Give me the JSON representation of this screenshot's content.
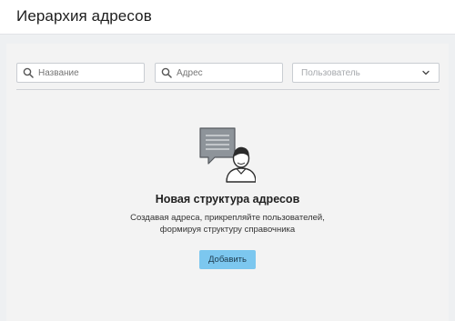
{
  "header": {
    "title": "Иерархия адресов"
  },
  "filters": {
    "name_placeholder": "Название",
    "address_placeholder": "Адрес",
    "user_placeholder": "Пользователь"
  },
  "empty_state": {
    "title": "Новая структура адресов",
    "description_line1": "Создавая адреса, прикрепляйте пользователей,",
    "description_line2": "формируя структуру справочника",
    "add_button_label": "Добавить",
    "illustration": "person-with-document-icon"
  },
  "colors": {
    "accent_button": "#7cc7ef",
    "panel_background": "#f3f3f3",
    "page_background": "#eef0f2"
  }
}
